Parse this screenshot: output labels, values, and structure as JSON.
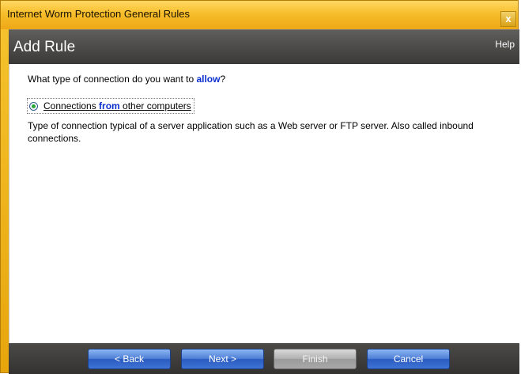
{
  "window": {
    "title": "Internet Worm Protection General Rules",
    "close_glyph": "x"
  },
  "header": {
    "title": "Add Rule",
    "help_label": "Help"
  },
  "content": {
    "question_prefix": "What type of connection do you want to ",
    "question_keyword": "allow",
    "question_suffix": "?",
    "option": {
      "label_prefix": "Connections ",
      "label_keyword": "from",
      "label_suffix": " other computers",
      "selected": true
    },
    "description": "Type of connection typical of a server application such as a Web server or FTP server. Also called inbound connections."
  },
  "footer": {
    "back_label": "< Back",
    "next_label": "Next >",
    "finish_label": "Finish",
    "cancel_label": "Cancel"
  },
  "colors": {
    "titlebar": "#f7be2b",
    "header": "#4a4947",
    "keyword": "#0a2fcf",
    "button": "#3f73d6",
    "button_disabled": "#a8a8a8"
  }
}
